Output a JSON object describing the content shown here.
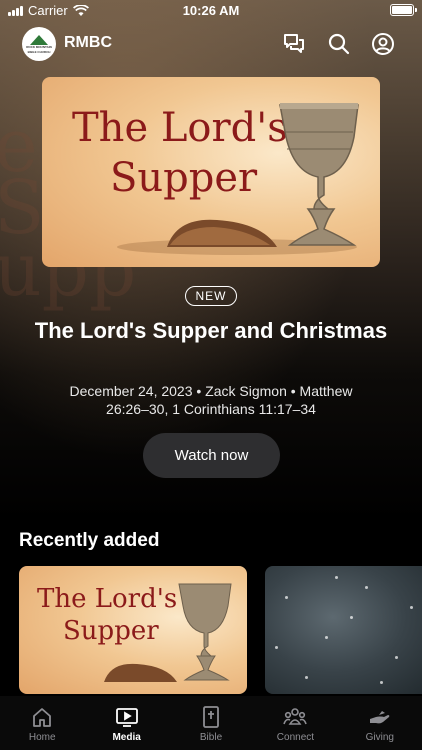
{
  "status_bar": {
    "carrier": "Carrier",
    "time": "10:26 AM"
  },
  "header": {
    "logo_text": "ROCK MOUNTAIN BIBLE CHURCH",
    "brand": "RMBC",
    "icons": [
      "chat-icon",
      "search-icon",
      "profile-icon"
    ]
  },
  "hero": {
    "artwork_title_line1": "The Lord's",
    "artwork_title_line2": "Supper",
    "badge": "NEW",
    "title": "The Lord's Supper and Christmas",
    "meta": "December 24, 2023 • Zack Sigmon • Matthew 26:26–30, 1 Corinthians 11:17–34",
    "watch_label": "Watch now"
  },
  "recent": {
    "section_title": "Recently added",
    "items": [
      {
        "artwork_line1": "The Lord's",
        "artwork_line2": "Supper"
      },
      {
        "artwork": "snow-scene"
      }
    ]
  },
  "tabbar": {
    "tabs": [
      {
        "label": "Home",
        "icon": "home-icon",
        "active": false
      },
      {
        "label": "Media",
        "icon": "media-icon",
        "active": true
      },
      {
        "label": "Bible",
        "icon": "bible-icon",
        "active": false
      },
      {
        "label": "Connect",
        "icon": "connect-icon",
        "active": false
      },
      {
        "label": "Giving",
        "icon": "giving-icon",
        "active": false
      }
    ]
  },
  "colors": {
    "accent": "#ffffff",
    "inactive_tab": "#8e8e93",
    "artwork_title": "#8b1a1a",
    "button_bg": "#2e2e30"
  }
}
